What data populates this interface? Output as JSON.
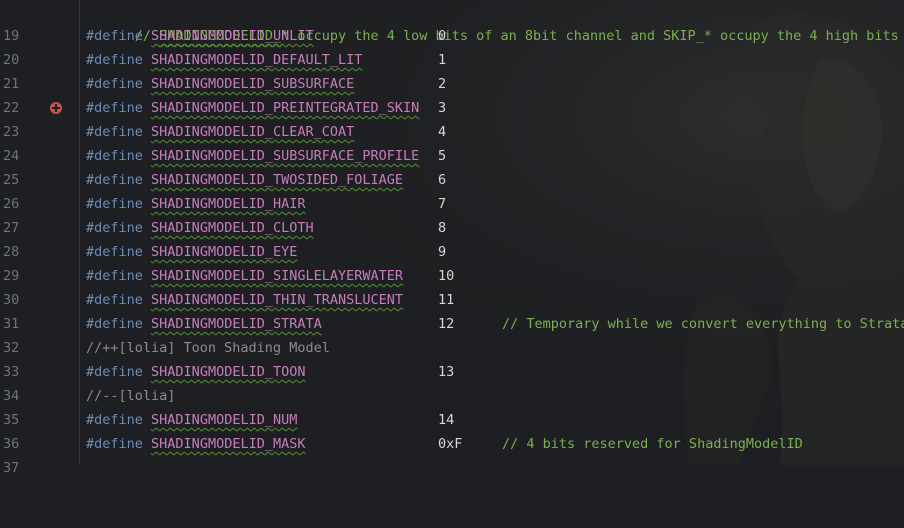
{
  "editor": {
    "header_comment_prefix": "// ",
    "header_macro": "SHADINGMODELID_",
    "header_comment_rest": "* occupy the 4 low bits of an 8bit channel and SKIP_* occupy the 4 high bits",
    "lines": [
      {
        "no": "19"
      },
      {
        "no": "20",
        "kw": "#define",
        "name": "SHADINGMODELID_UNLIT",
        "value": "0"
      },
      {
        "no": "21",
        "kw": "#define",
        "name": "SHADINGMODELID_DEFAULT_LIT",
        "value": "1"
      },
      {
        "no": "22",
        "kw": "#define",
        "name": "SHADINGMODELID_SUBSURFACE",
        "value": "2"
      },
      {
        "no": "23",
        "kw": "#define",
        "name": "SHADINGMODELID_PREINTEGRATED_SKIN",
        "value": "3"
      },
      {
        "no": "24",
        "kw": "#define",
        "name": "SHADINGMODELID_CLEAR_COAT",
        "value": "4"
      },
      {
        "no": "25",
        "kw": "#define",
        "name": "SHADINGMODELID_SUBSURFACE_PROFILE",
        "value": "5"
      },
      {
        "no": "26",
        "kw": "#define",
        "name": "SHADINGMODELID_TWOSIDED_FOLIAGE",
        "value": "6"
      },
      {
        "no": "27",
        "kw": "#define",
        "name": "SHADINGMODELID_HAIR",
        "value": "7"
      },
      {
        "no": "28",
        "kw": "#define",
        "name": "SHADINGMODELID_CLOTH",
        "value": "8"
      },
      {
        "no": "29",
        "kw": "#define",
        "name": "SHADINGMODELID_EYE",
        "value": "9"
      },
      {
        "no": "30",
        "kw": "#define",
        "name": "SHADINGMODELID_SINGLELAYERWATER",
        "value": "10"
      },
      {
        "no": "31",
        "kw": "#define",
        "name": "SHADINGMODELID_THIN_TRANSLUCENT",
        "value": "11"
      },
      {
        "no": "32",
        "kw": "#define",
        "name": "SHADINGMODELID_STRATA",
        "value": "12",
        "comment": "// Temporary while we convert everything to Strata"
      },
      {
        "no": "33",
        "text": "//++[lolia] Toon Shading Model"
      },
      {
        "no": "34",
        "kw": "#define",
        "name": "SHADINGMODELID_TOON",
        "value": "13"
      },
      {
        "no": "35",
        "text": "//--[lolia]"
      },
      {
        "no": "36",
        "kw": "#define",
        "name": "SHADINGMODELID_NUM",
        "value": "14"
      },
      {
        "no": "37",
        "kw": "#define",
        "name": "SHADINGMODELID_MASK",
        "value": "0xF",
        "comment": "// 4 bits reserved for ShadingModelID"
      }
    ]
  },
  "colors": {
    "background": "#1e1f22",
    "line_number": "#6f737a",
    "keyword": "#6b8fb5",
    "macro": "#c77dbb",
    "comment": "#7ab14f",
    "number": "#d7d7d7",
    "breakpoint_marker": "#c75450"
  },
  "icons": {
    "line_23_marker": "add-circle-icon"
  }
}
